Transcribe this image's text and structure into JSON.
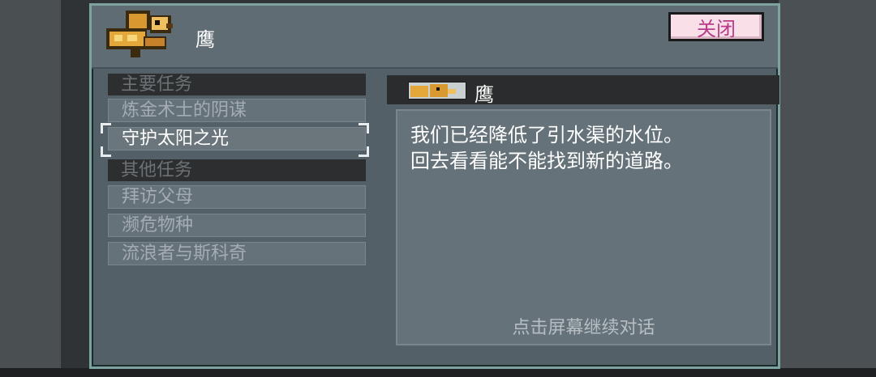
{
  "header": {
    "title": "鹰",
    "close_label": "关闭"
  },
  "quests": {
    "main_section": "主要任务",
    "main_items": [
      "炼金术士的阴谋",
      "守护太阳之光"
    ],
    "other_section": "其他任务",
    "other_items": [
      "拜访父母",
      "濒危物种",
      "流浪者与斯科奇"
    ]
  },
  "dialog": {
    "speaker": "鹰",
    "lines": [
      "我们已经降低了引水渠的水位。",
      "回去看看能不能找到新的道路。"
    ],
    "hint": "点击屏幕继续对话"
  },
  "colors": {
    "accent_frame": "#7da3a0",
    "close_button_bg": "#f8dfe8",
    "close_button_text": "#b83a88"
  }
}
